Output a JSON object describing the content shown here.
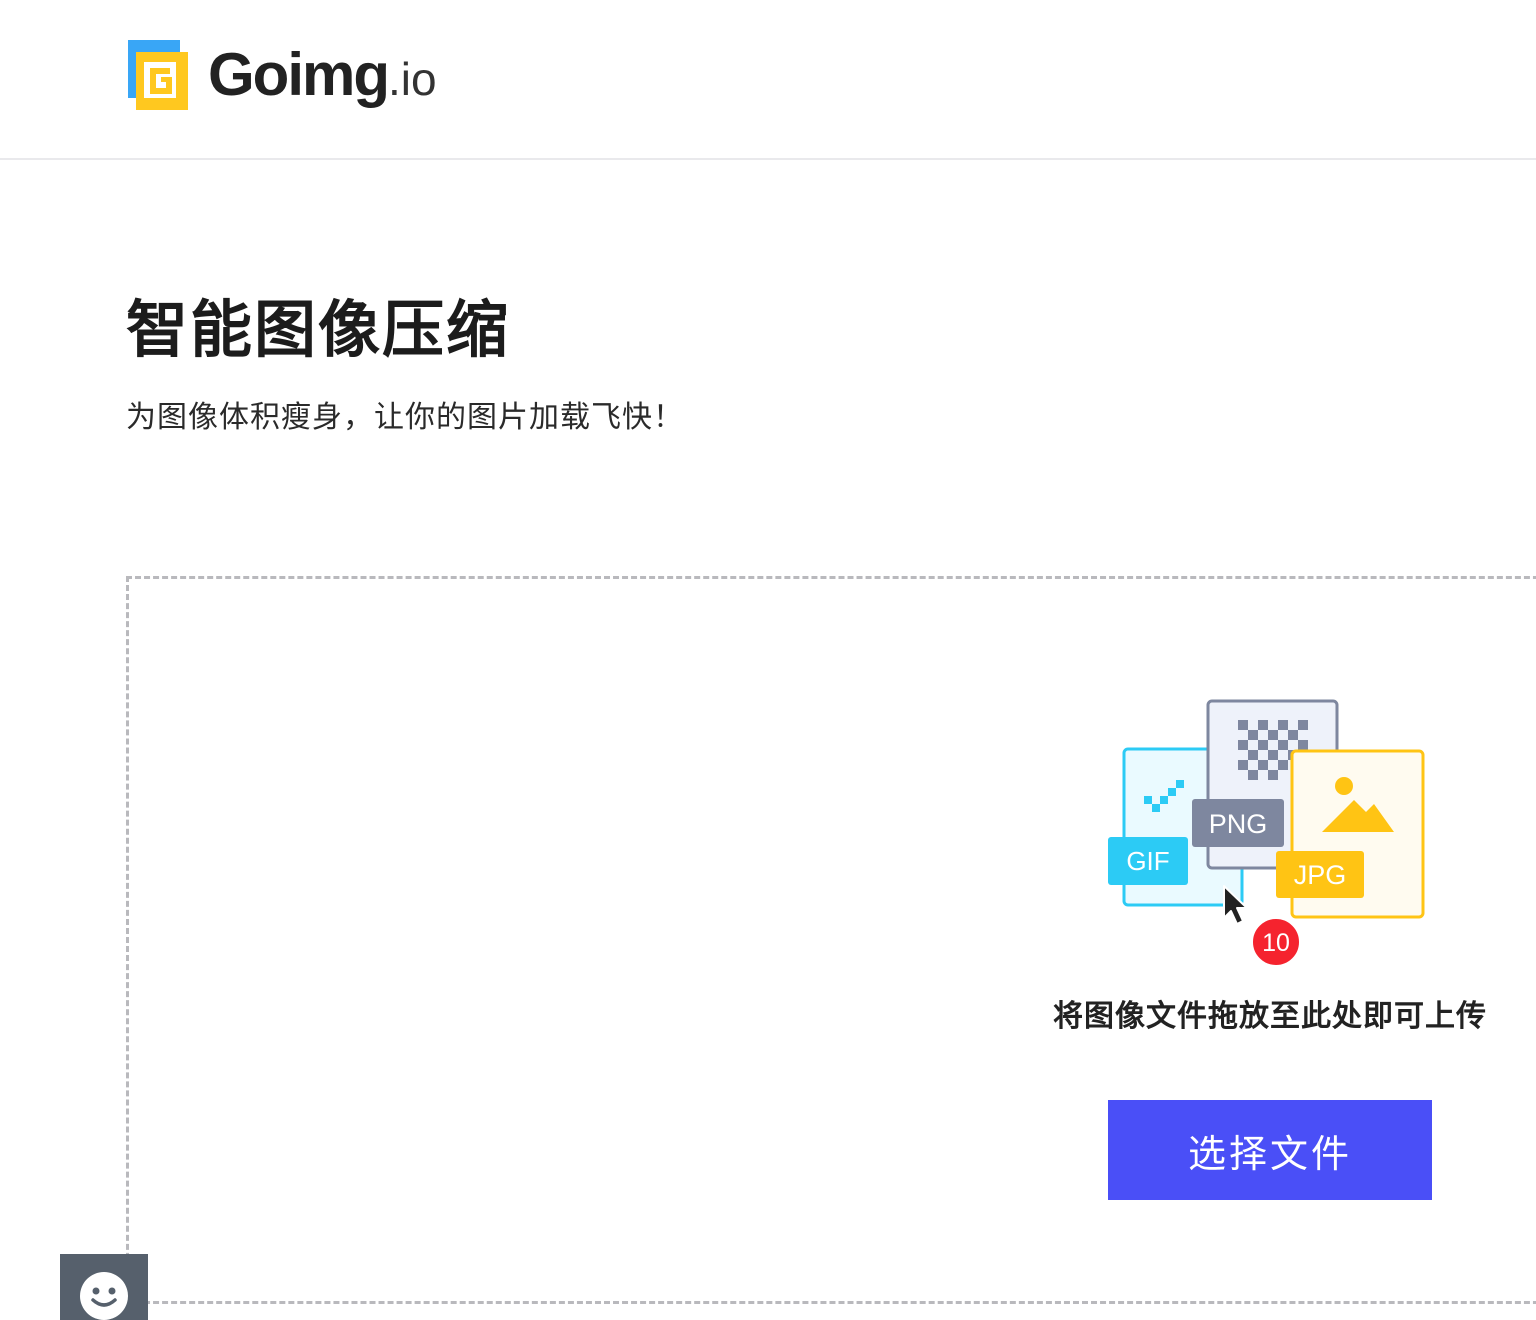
{
  "header": {
    "logo_text": "Goimg",
    "logo_suffix": ".io"
  },
  "hero": {
    "title": "智能图像压缩",
    "subtitle": "为图像体积瘦身，让你的图片加载飞快！"
  },
  "upload": {
    "formats": [
      "GIF",
      "PNG",
      "JPG"
    ],
    "file_count_badge": "10",
    "drop_hint": "将图像文件拖放至此处即可上传",
    "choose_button_label": "选择文件"
  },
  "feedback_widget": {
    "icon": "smiley-face-icon"
  },
  "colors": {
    "primary": "#4A4FF7",
    "gif": "#2CCBF5",
    "png": "#7E879F",
    "jpg": "#FFC414",
    "badge": "#F5232E",
    "logo_blue": "#39A6F6",
    "logo_yellow": "#FFC81F"
  }
}
